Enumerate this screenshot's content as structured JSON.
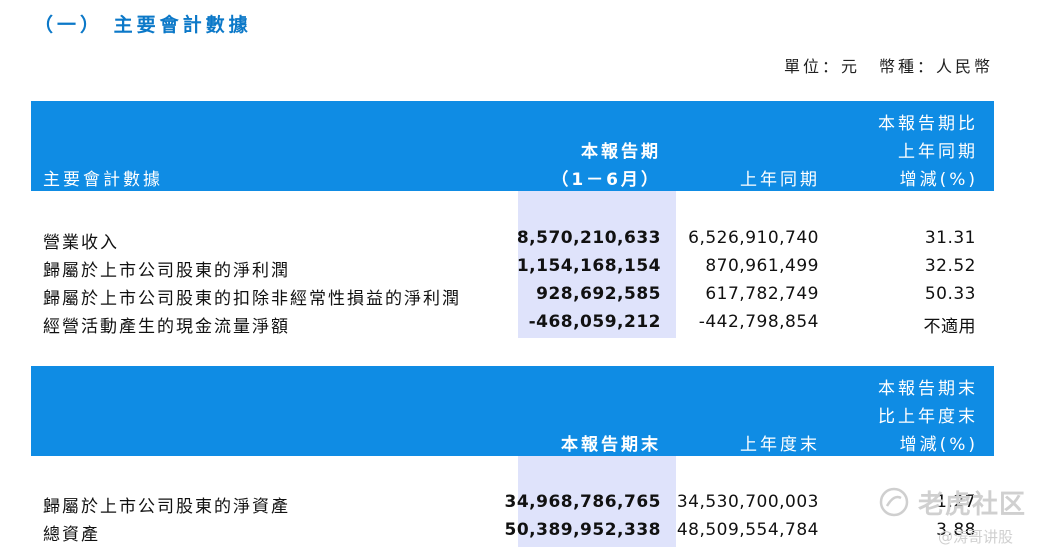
{
  "title": "（一） 主要會計數據",
  "unit_line": "單位：元　幣種：人民幣",
  "table1": {
    "header": {
      "label": "主要會計數據",
      "current_line1": "本報告期",
      "current_line2": "（1－6月）",
      "prior": "上年同期",
      "change_line1": "本報告期比",
      "change_line2": "上年同期",
      "change_line3": "增減(%)"
    },
    "rows": [
      {
        "label": "營業收入",
        "current": "8,570,210,633",
        "prior": "6,526,910,740",
        "change": "31.31"
      },
      {
        "label": "歸屬於上市公司股東的淨利潤",
        "current": "1,154,168,154",
        "prior": "870,961,499",
        "change": "32.52"
      },
      {
        "label": "歸屬於上市公司股東的扣除非經常性損益的淨利潤",
        "current": "928,692,585",
        "prior": "617,782,749",
        "change": "50.33"
      },
      {
        "label": "經營活動產生的現金流量淨額",
        "current": "-468,059,212",
        "prior": "-442,798,854",
        "change": "不適用"
      }
    ]
  },
  "table2": {
    "header": {
      "current": "本報告期末",
      "prior": "上年度末",
      "change_line1": "本報告期末",
      "change_line2": "比上年度末",
      "change_line3": "增減(%)"
    },
    "rows": [
      {
        "label": "歸屬於上市公司股東的淨資產",
        "current": "34,968,786,765",
        "prior": "34,530,700,003",
        "change": "1.27"
      },
      {
        "label": "總資產",
        "current": "50,389,952,338",
        "prior": "48,509,554,784",
        "change": "3.88"
      }
    ]
  },
  "watermark": {
    "brand": "老虎社区",
    "user": "@涛哥讲股"
  }
}
